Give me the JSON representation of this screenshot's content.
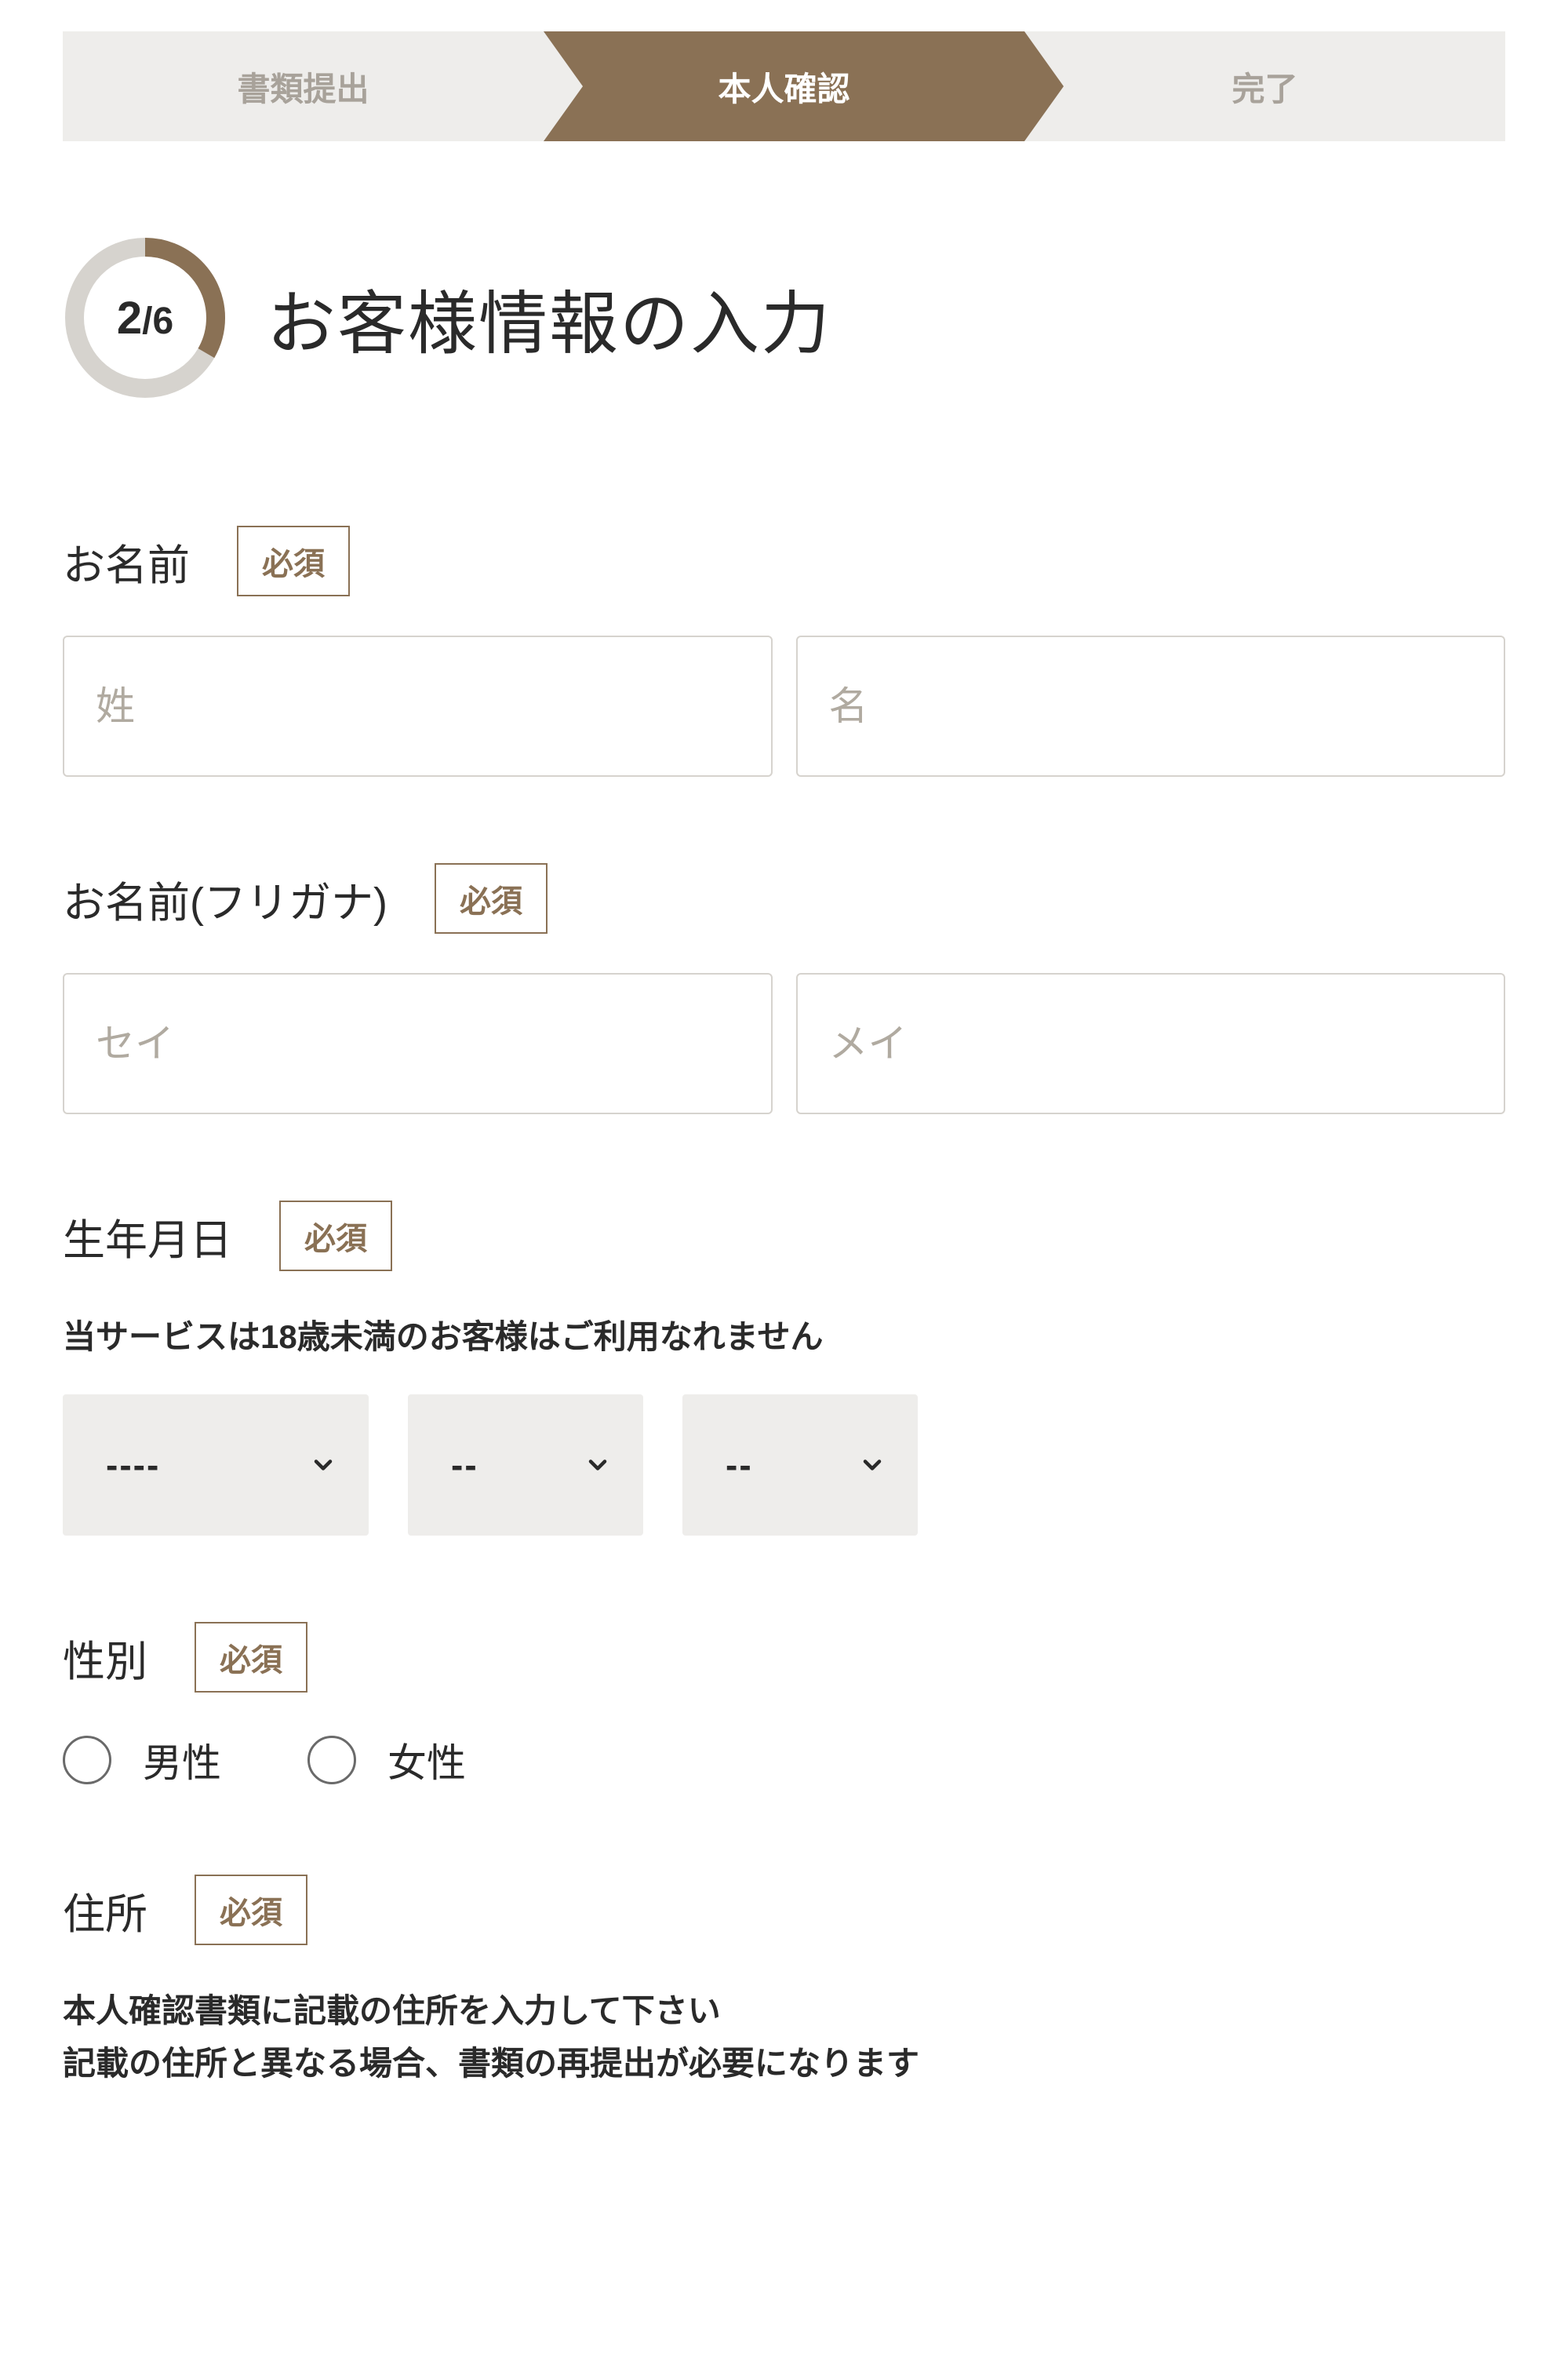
{
  "stepper": {
    "step1": "書類提出",
    "step2": "本人確認",
    "step3": "完了"
  },
  "progress": {
    "current": "2",
    "total": "6"
  },
  "page_title": "お客様情報の入力",
  "required_label": "必須",
  "name": {
    "label": "お名前",
    "placeholder_last": "姓",
    "placeholder_first": "名"
  },
  "furigana": {
    "label": "お名前(フリガナ)",
    "placeholder_last": "セイ",
    "placeholder_first": "メイ"
  },
  "birthdate": {
    "label": "生年月日",
    "helper": "当サービスは18歳未満のお客様はご利用なれません",
    "year": "----",
    "month": "--",
    "day": "--"
  },
  "gender": {
    "label": "性別",
    "option_male": "男性",
    "option_female": "女性"
  },
  "address": {
    "label": "住所",
    "helper_line1": "本人確認書類に記載の住所を入力して下さい",
    "helper_line2": "記載の住所と異なる場合、書類の再提出が必要になります"
  }
}
